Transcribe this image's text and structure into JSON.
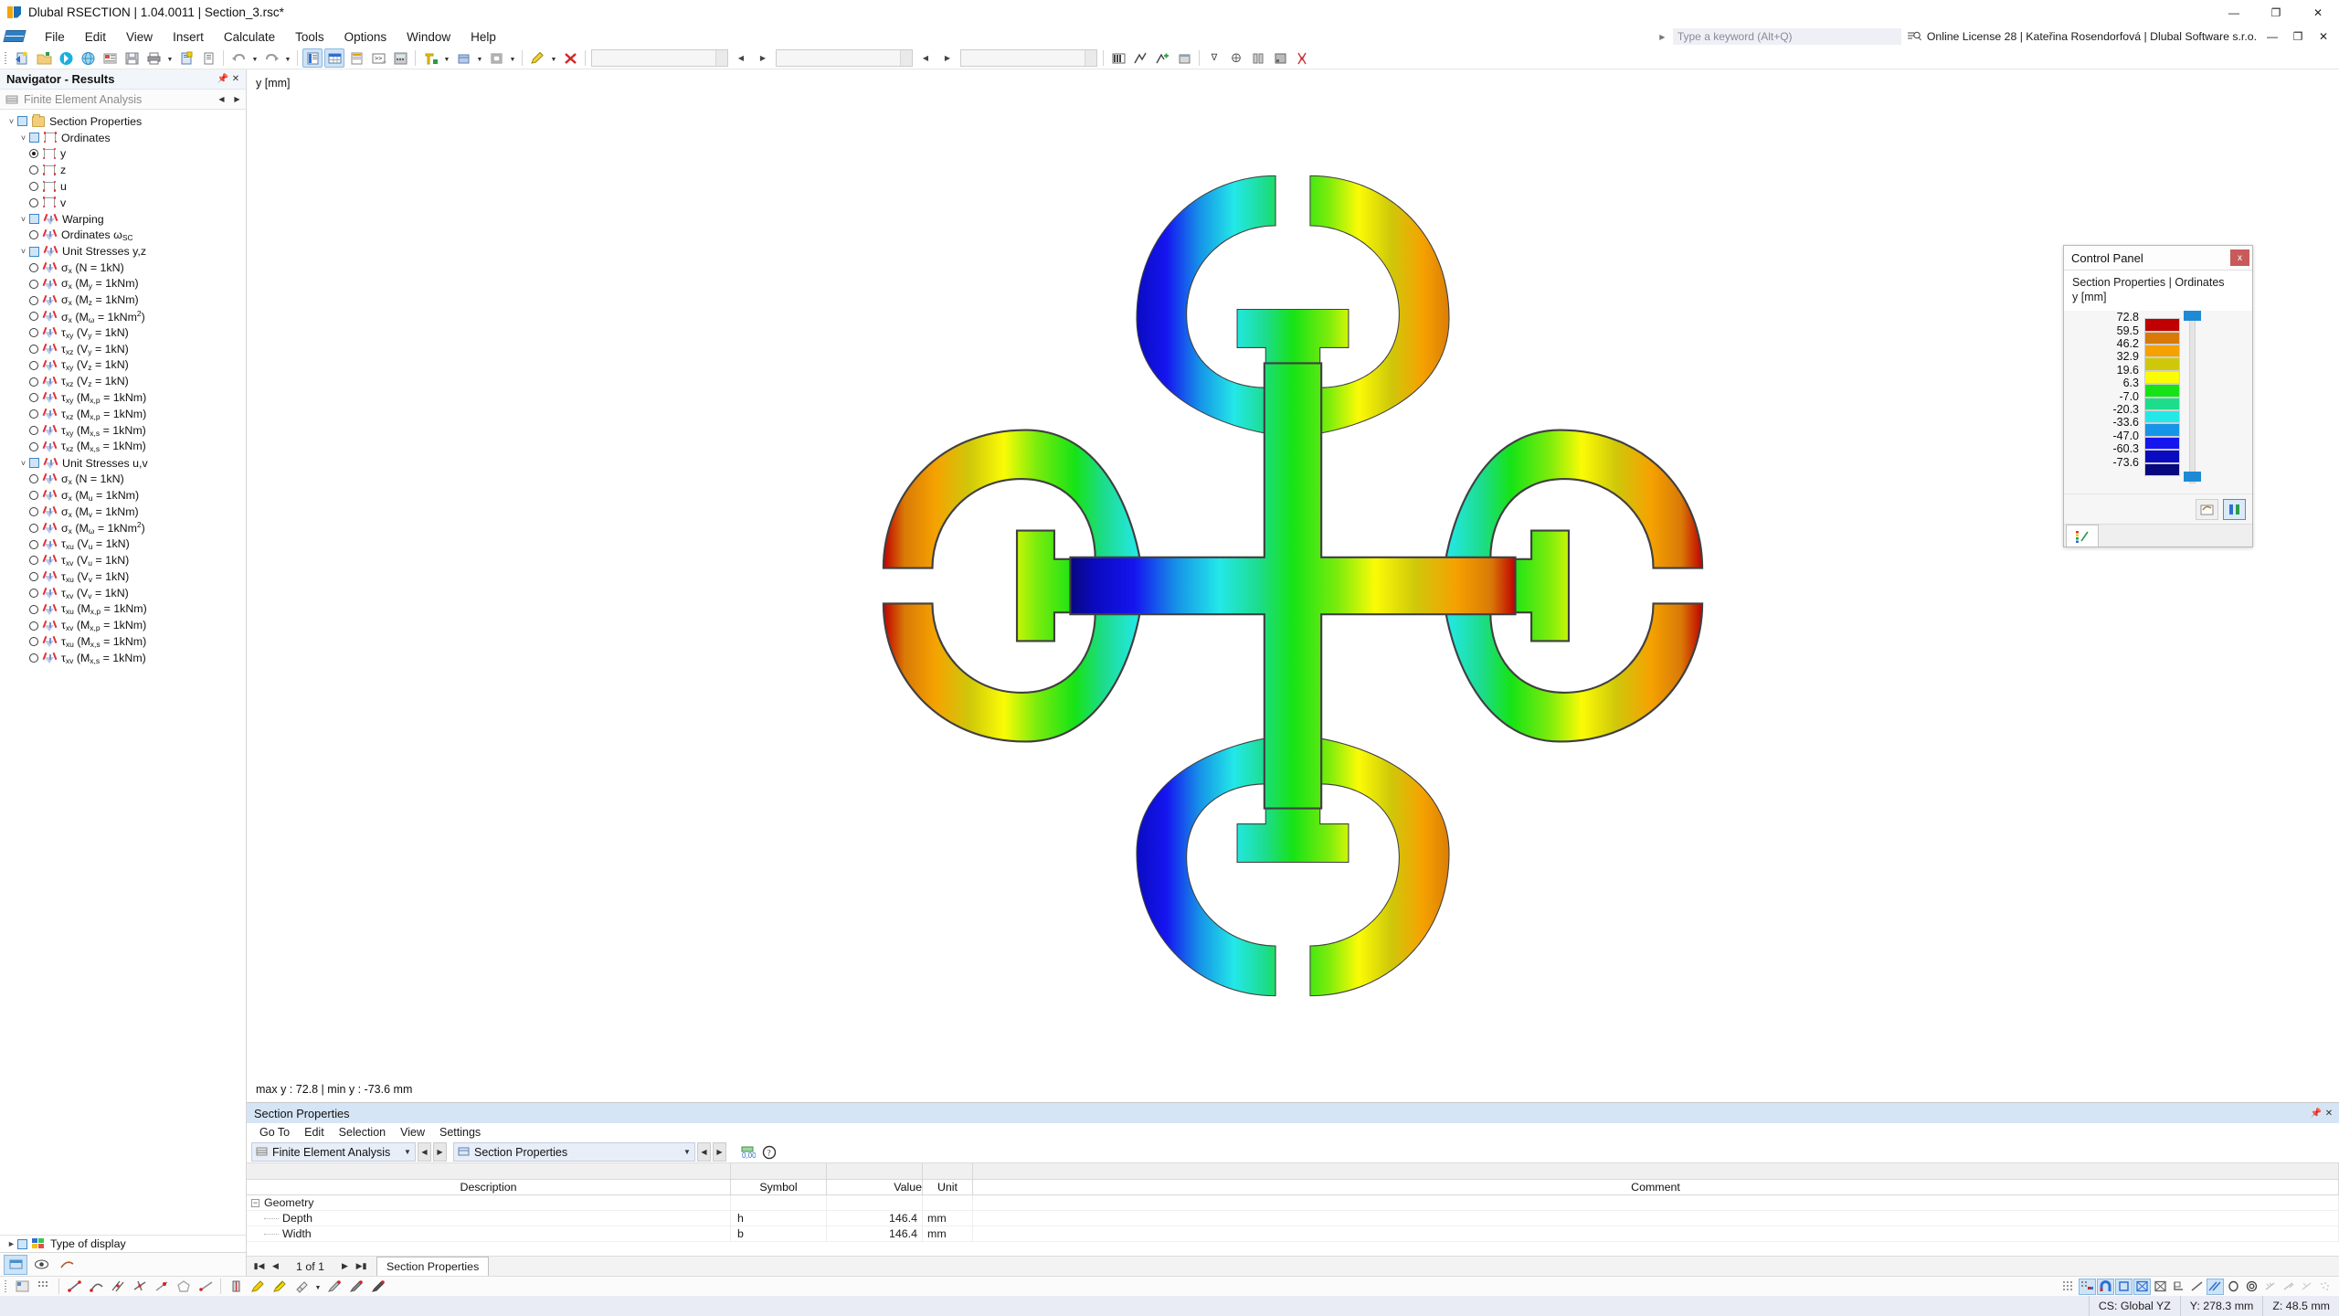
{
  "titlebar": {
    "text": "Dlubal RSECTION | 1.04.0011 | Section_3.rsc*",
    "minimize": "—",
    "maximize": "❐",
    "close": "✕"
  },
  "menubar": {
    "items": [
      "File",
      "Edit",
      "View",
      "Insert",
      "Calculate",
      "Tools",
      "Options",
      "Window",
      "Help"
    ],
    "search_placeholder": "Type a keyword (Alt+Q)",
    "license": "Online License 28 | Kateřina Rosendorfová | Dlubal Software s.r.o."
  },
  "navigator": {
    "title": "Navigator - Results",
    "subtitle": "Finite Element Analysis",
    "tree": [
      {
        "level": 0,
        "type": "folder",
        "expand": "v",
        "check": true,
        "label": "Section Properties"
      },
      {
        "level": 1,
        "type": "ord",
        "expand": "v",
        "check": true,
        "label": "Ordinates"
      },
      {
        "level": 2,
        "type": "ord",
        "radio": "sel",
        "label": "y"
      },
      {
        "level": 2,
        "type": "ord",
        "radio": "off",
        "label": "z"
      },
      {
        "level": 2,
        "type": "ord",
        "radio": "off",
        "label": "u"
      },
      {
        "level": 2,
        "type": "ord",
        "radio": "off",
        "label": "v"
      },
      {
        "level": 1,
        "type": "wp",
        "expand": "v",
        "check": true,
        "label": "Warping"
      },
      {
        "level": 2,
        "type": "wp",
        "radio": "off",
        "label": "Ordinates ω_SC",
        "base": "Ordinates ω",
        "subtext": "SC"
      },
      {
        "level": 1,
        "type": "wp",
        "expand": "v",
        "check": true,
        "label": "Unit Stresses y,z"
      },
      {
        "level": 2,
        "type": "wp",
        "radio": "off",
        "base": "σ",
        "subtext": "x",
        "tail": " (N = 1kN)"
      },
      {
        "level": 2,
        "type": "wp",
        "radio": "off",
        "base": "σ",
        "subtext": "x",
        "tail": " (M",
        "tail2": "y",
        "tail3": " = 1kNm)"
      },
      {
        "level": 2,
        "type": "wp",
        "radio": "off",
        "base": "σ",
        "subtext": "x",
        "tail": " (M",
        "tail2": "z",
        "tail3": " = 1kNm)"
      },
      {
        "level": 2,
        "type": "wp",
        "radio": "off",
        "base": "σ",
        "subtext": "x",
        "tail": " (M",
        "tail2": "ω",
        "tail3": " = 1kNm²)"
      },
      {
        "level": 2,
        "type": "wp",
        "radio": "off",
        "base": "τ",
        "subtext": "xy",
        "tail": " (V",
        "tail2": "y",
        "tail3": " = 1kN)"
      },
      {
        "level": 2,
        "type": "wp",
        "radio": "off",
        "base": "τ",
        "subtext": "xz",
        "tail": " (V",
        "tail2": "y",
        "tail3": " = 1kN)"
      },
      {
        "level": 2,
        "type": "wp",
        "radio": "off",
        "base": "τ",
        "subtext": "xy",
        "tail": " (V",
        "tail2": "z",
        "tail3": " = 1kN)"
      },
      {
        "level": 2,
        "type": "wp",
        "radio": "off",
        "base": "τ",
        "subtext": "xz",
        "tail": " (V",
        "tail2": "z",
        "tail3": " = 1kN)"
      },
      {
        "level": 2,
        "type": "wp",
        "radio": "off",
        "base": "τ",
        "subtext": "xy",
        "tail": " (M",
        "tail2": "x,p",
        "tail3": " = 1kNm)"
      },
      {
        "level": 2,
        "type": "wp",
        "radio": "off",
        "base": "τ",
        "subtext": "xz",
        "tail": " (M",
        "tail2": "x,p",
        "tail3": " = 1kNm)"
      },
      {
        "level": 2,
        "type": "wp",
        "radio": "off",
        "base": "τ",
        "subtext": "xy",
        "tail": " (M",
        "tail2": "x,s",
        "tail3": " = 1kNm)"
      },
      {
        "level": 2,
        "type": "wp",
        "radio": "off",
        "base": "τ",
        "subtext": "xz",
        "tail": " (M",
        "tail2": "x,s",
        "tail3": " = 1kNm)"
      },
      {
        "level": 1,
        "type": "wp",
        "expand": "v",
        "check": true,
        "label": "Unit Stresses u,v"
      },
      {
        "level": 2,
        "type": "wp",
        "radio": "off",
        "base": "σ",
        "subtext": "x",
        "tail": " (N = 1kN)"
      },
      {
        "level": 2,
        "type": "wp",
        "radio": "off",
        "base": "σ",
        "subtext": "x",
        "tail": " (M",
        "tail2": "u",
        "tail3": " = 1kNm)"
      },
      {
        "level": 2,
        "type": "wp",
        "radio": "off",
        "base": "σ",
        "subtext": "x",
        "tail": " (M",
        "tail2": "v",
        "tail3": " = 1kNm)"
      },
      {
        "level": 2,
        "type": "wp",
        "radio": "off",
        "base": "σ",
        "subtext": "x",
        "tail": " (M",
        "tail2": "ω",
        "tail3": " = 1kNm²)"
      },
      {
        "level": 2,
        "type": "wp",
        "radio": "off",
        "base": "τ",
        "subtext": "xu",
        "tail": " (V",
        "tail2": "u",
        "tail3": " = 1kN)"
      },
      {
        "level": 2,
        "type": "wp",
        "radio": "off",
        "base": "τ",
        "subtext": "xv",
        "tail": " (V",
        "tail2": "u",
        "tail3": " = 1kN)"
      },
      {
        "level": 2,
        "type": "wp",
        "radio": "off",
        "base": "τ",
        "subtext": "xu",
        "tail": " (V",
        "tail2": "v",
        "tail3": " = 1kN)"
      },
      {
        "level": 2,
        "type": "wp",
        "radio": "off",
        "base": "τ",
        "subtext": "xv",
        "tail": " (V",
        "tail2": "v",
        "tail3": " = 1kN)"
      },
      {
        "level": 2,
        "type": "wp",
        "radio": "off",
        "base": "τ",
        "subtext": "xu",
        "tail": " (M",
        "tail2": "x,p",
        "tail3": " = 1kNm)"
      },
      {
        "level": 2,
        "type": "wp",
        "radio": "off",
        "base": "τ",
        "subtext": "xv",
        "tail": " (M",
        "tail2": "x,p",
        "tail3": " = 1kNm)"
      },
      {
        "level": 2,
        "type": "wp",
        "radio": "off",
        "base": "τ",
        "subtext": "xu",
        "tail": " (M",
        "tail2": "x,s",
        "tail3": " = 1kNm)"
      },
      {
        "level": 2,
        "type": "wp",
        "radio": "off",
        "base": "τ",
        "subtext": "xv",
        "tail": " (M",
        "tail2": "x,s",
        "tail3": " = 1kNm)"
      }
    ],
    "type_of_display": "Type of display"
  },
  "canvas": {
    "axis_label": "y [mm]",
    "minmax": "max y : 72.8 | min y : -73.6 mm"
  },
  "control_panel": {
    "title": "Control Panel",
    "close": "x",
    "subtitle_line1": "Section Properties | Ordinates",
    "subtitle_line2": "y [mm]",
    "ticks": [
      "72.8",
      "59.5",
      "46.2",
      "32.9",
      "19.6",
      "6.3",
      "-7.0",
      "-20.3",
      "-33.6",
      "-47.0",
      "-60.3",
      "-73.6"
    ],
    "colors": [
      "#c00000",
      "#d97a06",
      "#f5a201",
      "#cfc80a",
      "#fbfb06",
      "#16e316",
      "#1ddc8b",
      "#23e8e8",
      "#1694e8",
      "#1515f0",
      "#0a0ac0",
      "#08087e"
    ]
  },
  "bottom_panel": {
    "title": "Section Properties",
    "menu": [
      "Go To",
      "Edit",
      "Selection",
      "View",
      "Settings"
    ],
    "combo1": "Finite Element Analysis",
    "combo2": "Section Properties",
    "columns": [
      "Description",
      "Symbol",
      "Value",
      "Unit",
      "Comment"
    ],
    "rows": [
      {
        "kind": "group",
        "description": "Geometry",
        "symbol": "",
        "value": "",
        "unit": "",
        "comment": ""
      },
      {
        "kind": "item",
        "description": "Depth",
        "symbol": "h",
        "value": "146.4",
        "unit": "mm",
        "comment": ""
      },
      {
        "kind": "item",
        "description": "Width",
        "symbol": "b",
        "value": "146.4",
        "unit": "mm",
        "comment": ""
      }
    ],
    "page_info": "1 of 1",
    "tab": "Section Properties"
  },
  "statusbar": {
    "cs": "CS: Global YZ",
    "y": "Y: 278.3 mm",
    "z": "Z: 48.5 mm"
  },
  "chart_data": {
    "type": "heatmap",
    "title": "Section Properties | Ordinates y [mm]",
    "ylabel": "y [mm]",
    "legend_position": "right",
    "colorbar_ticks": [
      72.8,
      59.5,
      46.2,
      32.9,
      19.6,
      6.3,
      -7.0,
      -20.3,
      -33.6,
      -47.0,
      -60.3,
      -73.6
    ],
    "colorbar_colors": [
      "#c00000",
      "#d97a06",
      "#f5a201",
      "#cfc80a",
      "#fbfb06",
      "#16e316",
      "#1ddc8b",
      "#23e8e8",
      "#1694e8",
      "#1515f0",
      "#0a0ac0",
      "#08087e"
    ],
    "value_range": [
      -73.6,
      72.8
    ],
    "max_label": "max y : 72.8",
    "min_label": "min y : -73.6 mm",
    "section_depth_mm": 146.4,
    "section_width_mm": 146.4,
    "description": "Cruciform cross-section with four C-shaped lobes; y-ordinate field varying left (-73.6, dark blue) to right (+72.8, dark red)."
  }
}
